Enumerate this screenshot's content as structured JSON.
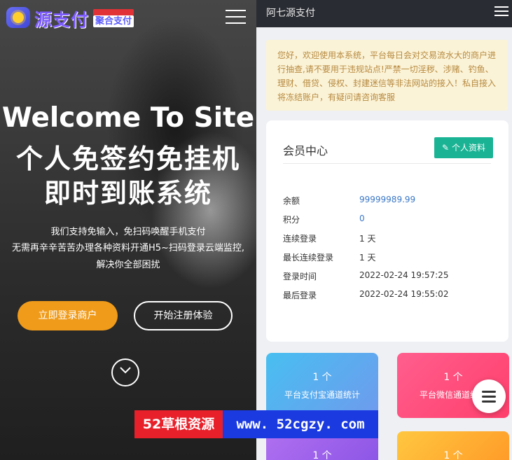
{
  "left": {
    "logo": {
      "brand": "源支付",
      "badge": "聚合支付"
    },
    "hero": {
      "title_en": "Welcome To Site",
      "title_line2": "个人免签约免挂机",
      "title_line3": "即时到账系统"
    },
    "subtitle": {
      "line1": "我们支持免输入，免扫码唤醒手机支付",
      "line2": "无需再辛辛苦苦办理各种资料开通H5~扫码登录云端监控,",
      "line3": "解决你全部困扰"
    },
    "buttons": {
      "login": "立即登录商户",
      "register": "开始注册体验"
    }
  },
  "watermark": {
    "red": "52草根资源",
    "blue": "www. 52cgzy. com"
  },
  "right": {
    "topbar": {
      "title": "阿七源支付"
    },
    "notice": "您好，欢迎使用本系统，平台每日会对交易流水大的商户进行抽查,请不要用于违规站点!严禁一切淫秽、涉赌、钓鱼、理财、借贷、侵权、封建迷信等非法网站的接入！私自接入将冻结账户，有疑问请咨询客服",
    "member": {
      "title": "会员中心",
      "profile_button": "个人资料",
      "rows": [
        {
          "key": "余额",
          "value": "99999989.99"
        },
        {
          "key": "积分",
          "value": "0"
        },
        {
          "key": "连续登录",
          "value": "1 天"
        },
        {
          "key": "最长连续登录",
          "value": "1 天"
        },
        {
          "key": "登录时间",
          "value": "2022-02-24 19:57:25"
        },
        {
          "key": "最后登录",
          "value": "2022-02-24 19:55:02"
        }
      ]
    },
    "stats": [
      {
        "count": "1 个",
        "label": "平台支付宝通道统计",
        "color": "#48bff0"
      },
      {
        "count": "1 个",
        "label": "平台微信通道统计",
        "color": "#ff5e8e"
      },
      {
        "count": "1 个",
        "label": "",
        "color": "#b070f0"
      },
      {
        "count": "1 个",
        "label": "",
        "color": "#ffc740"
      }
    ]
  }
}
